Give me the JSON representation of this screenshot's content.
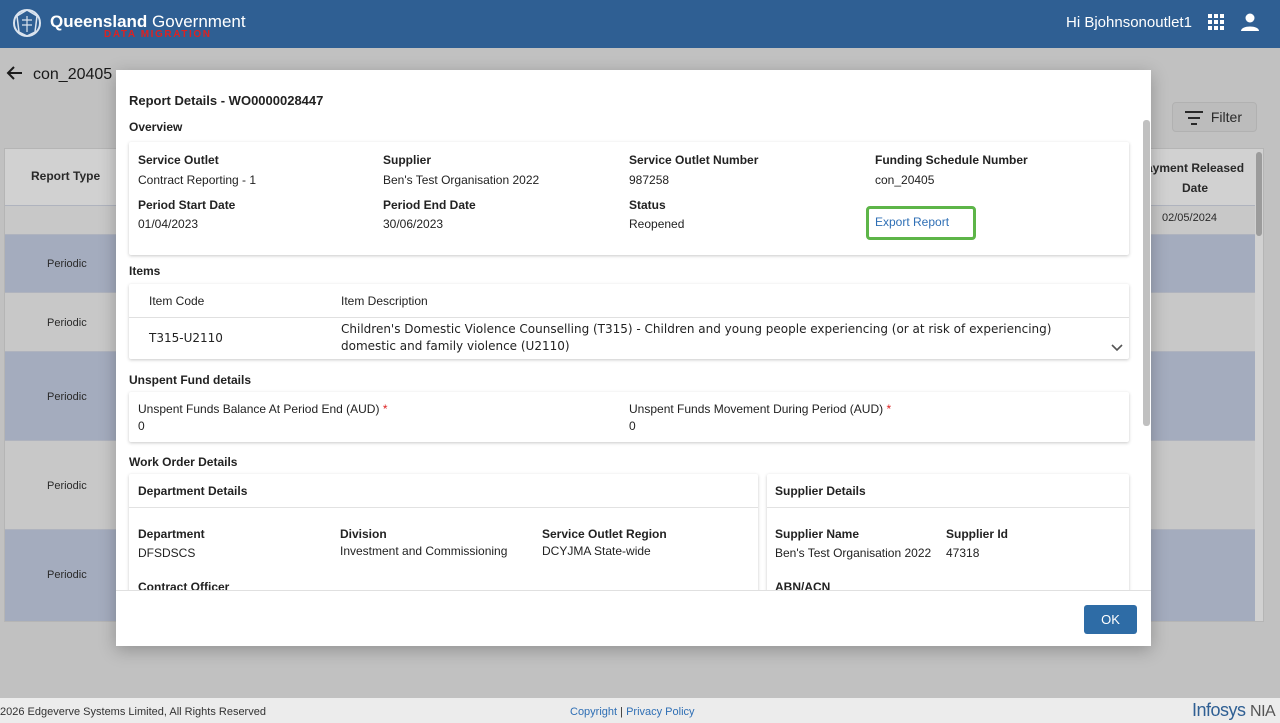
{
  "header": {
    "brand_main": "Queensland",
    "brand_gov": "Government",
    "brand_sub": "DATA MIGRATION",
    "greeting": "Hi Bjohnsonoutlet1"
  },
  "page": {
    "title": "con_20405",
    "filter_label": "Filter",
    "table": {
      "col_report_type": "Report Type",
      "col_payment_released": "ayment Released Date",
      "first_date": "02/05/2024",
      "rows": [
        "Periodic",
        "Periodic",
        "Periodic",
        "Periodic",
        "Periodic"
      ]
    }
  },
  "footer": {
    "copyright_text": "2026 Edgeverve Systems Limited, All Rights Reserved",
    "copyright_link": "Copyright",
    "separator": "|",
    "privacy_link": "Privacy Policy",
    "logo_infosys": "Infosys",
    "logo_nia": "NIA"
  },
  "modal": {
    "title": "Report Details - WO0000028447",
    "ok_label": "OK",
    "overview": {
      "heading": "Overview",
      "service_outlet_label": "Service Outlet",
      "service_outlet_value": "Contract Reporting - 1",
      "supplier_label": "Supplier",
      "supplier_value": "Ben's Test Organisation 2022",
      "service_outlet_number_label": "Service Outlet Number",
      "service_outlet_number_value": "987258",
      "funding_schedule_label": "Funding Schedule Number",
      "funding_schedule_value": "con_20405",
      "period_start_label": "Period Start Date",
      "period_start_value": "01/04/2023",
      "period_end_label": "Period End Date",
      "period_end_value": "30/06/2023",
      "status_label": "Status",
      "status_value": "Reopened",
      "export_link": "Export Report"
    },
    "items": {
      "heading": "Items",
      "col_code": "Item Code",
      "col_description": "Item Description",
      "rows": [
        {
          "code": "T315-U2110",
          "description_line1": "Children's Domestic Violence Counselling (T315) - Children and young people experiencing (or at risk of experiencing)",
          "description_line2": "domestic and family violence (U2110)"
        }
      ]
    },
    "unspent": {
      "heading": "Unspent Fund details",
      "balance_label": "Unspent Funds Balance At Period End (AUD)",
      "balance_value": "0",
      "movement_label": "Unspent Funds Movement During Period (AUD)",
      "movement_value": "0",
      "required_mark": "*"
    },
    "work_order": {
      "heading": "Work Order Details",
      "department_details": {
        "heading": "Department Details",
        "department_label": "Department",
        "department_value": "DFSDSCS",
        "division_label": "Division",
        "division_value": "Investment and Commissioning",
        "region_label": "Service Outlet Region",
        "region_value": "DCYJMA State-wide",
        "contract_officer_label": "Contract Officer"
      },
      "supplier_details": {
        "heading": "Supplier Details",
        "name_label": "Supplier Name",
        "name_value": "Ben's Test Organisation 2022",
        "id_label": "Supplier Id",
        "id_value": "47318",
        "abn_label": "ABN/ACN"
      }
    }
  }
}
